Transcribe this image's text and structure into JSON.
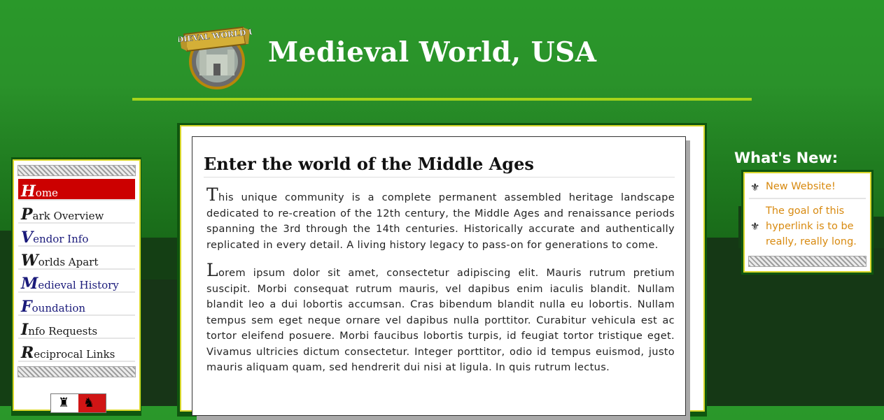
{
  "header": {
    "site_title": "Medieval World, USA",
    "logo_text": "MEDIEVAL WORLD USA"
  },
  "nav": {
    "items": [
      {
        "initial": "H",
        "rest": "ome",
        "active": true
      },
      {
        "initial": "P",
        "rest": "ark Overview",
        "active": false
      },
      {
        "initial": "V",
        "rest": "endor Info",
        "active": false
      },
      {
        "initial": "W",
        "rest": "orlds Apart",
        "active": false
      },
      {
        "initial": "M",
        "rest": "edieval History",
        "active": false
      },
      {
        "initial": "F",
        "rest": "oundation",
        "active": false
      },
      {
        "initial": "I",
        "rest": "nfo Requests",
        "active": false
      },
      {
        "initial": "R",
        "rest": "eciprocal Links",
        "active": false
      }
    ]
  },
  "main": {
    "heading": "Enter the world of the Middle Ages",
    "paragraphs": [
      {
        "initial": "T",
        "rest": "his unique community is a complete permanent assembled heritage landscape dedicated to re-creation of the 12th century, the Middle Ages and renaissance periods spanning the 3rd through the 14th centuries. Historically accurate and authentically replicated in every detail. A living history legacy to pass-on for generations to come."
      },
      {
        "initial": "L",
        "rest": "orem ipsum dolor sit amet, consectetur adipiscing elit. Mauris rutrum pretium suscipit. Morbi consequat rutrum mauris, vel dapibus enim iaculis blandit. Nullam blandit leo a dui lobortis accumsan. Cras bibendum blandit nulla eu lobortis. Nullam tempus sem eget neque ornare vel dapibus nulla porttitor. Curabitur vehicula est ac tortor eleifend posuere. Morbi faucibus lobortis turpis, id feugiat tortor tristique eget. Vivamus ultricies dictum consectetur. Integer porttitor, odio id tempus euismod, justo mauris aliquam quam, sed hendrerit dui nisi at ligula. In quis rutrum lectus."
      }
    ]
  },
  "whats_new": {
    "title": "What's New:",
    "items": [
      {
        "label": "New Website!",
        "icon": "fleur-de-lis-icon"
      },
      {
        "label": "The goal of this hyperlink is to be really, really long.",
        "icon": "fleur-de-lis-icon"
      }
    ]
  },
  "colors": {
    "accent_line": "#a6d41a",
    "panel_border": "#d9d72a",
    "nav_active": "#cc0000",
    "news_link": "#d88a10"
  }
}
